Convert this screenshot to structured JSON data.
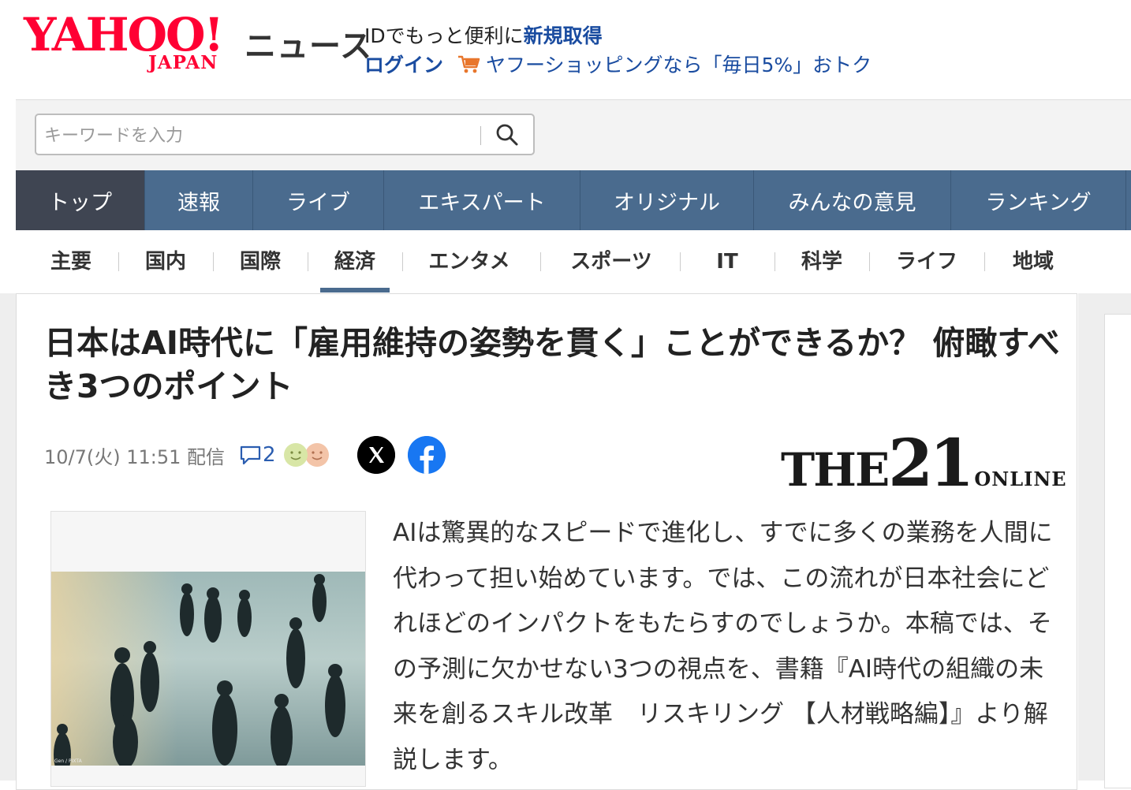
{
  "header": {
    "logo_text": "YAHOO!",
    "logo_sub": "JAPAN",
    "service_name": "ニュース",
    "id_prompt": "IDでもっと便利に",
    "signup_label": "新規取得",
    "login_label": "ログイン",
    "shopping_promo": "ヤフーショッピングなら「毎日5%」おトク",
    "cart_icon": "shopping-cart-icon"
  },
  "search": {
    "placeholder": "キーワードを入力",
    "icon": "search-icon"
  },
  "main_nav": [
    {
      "label": "トップ",
      "active": true
    },
    {
      "label": "速報"
    },
    {
      "label": "ライブ"
    },
    {
      "label": "エキスパート"
    },
    {
      "label": "オリジナル"
    },
    {
      "label": "みんなの意見"
    },
    {
      "label": "ランキング"
    }
  ],
  "sub_nav": [
    {
      "label": "主要"
    },
    {
      "label": "国内"
    },
    {
      "label": "国際"
    },
    {
      "label": "経済",
      "active": true
    },
    {
      "label": "エンタメ"
    },
    {
      "label": "スポーツ"
    },
    {
      "label": "IT"
    },
    {
      "label": "科学"
    },
    {
      "label": "ライフ"
    },
    {
      "label": "地域"
    }
  ],
  "article": {
    "title": "日本はAI時代に「雇用維持の姿勢を貫く」ことができるか？ 俯瞰すべき3つのポイント",
    "date": "10/7(火) 11:51 配信",
    "comment_count": "2",
    "publisher": {
      "name": "THE",
      "number": "21",
      "suffix": "ONLINE"
    },
    "lead": "AIは驚異的なスピードで進化し、すでに多くの業務を人間に代わって担い始めています。では、この流れが日本社会にどれほどのインパクトをもたらすのでしょうか。本稿では、その予測に欠かせない3つの視点を、書籍『AI時代の組織の未来を創るスキル改革　リスキリング 【人材戦略編】』より解説します。",
    "photo_credit": "Gen / PIXTA"
  },
  "colors": {
    "brand_red": "#ff0033",
    "nav_blue": "#4a6b8e",
    "nav_active": "#3f4552",
    "link_blue": "#1a4ca0"
  }
}
